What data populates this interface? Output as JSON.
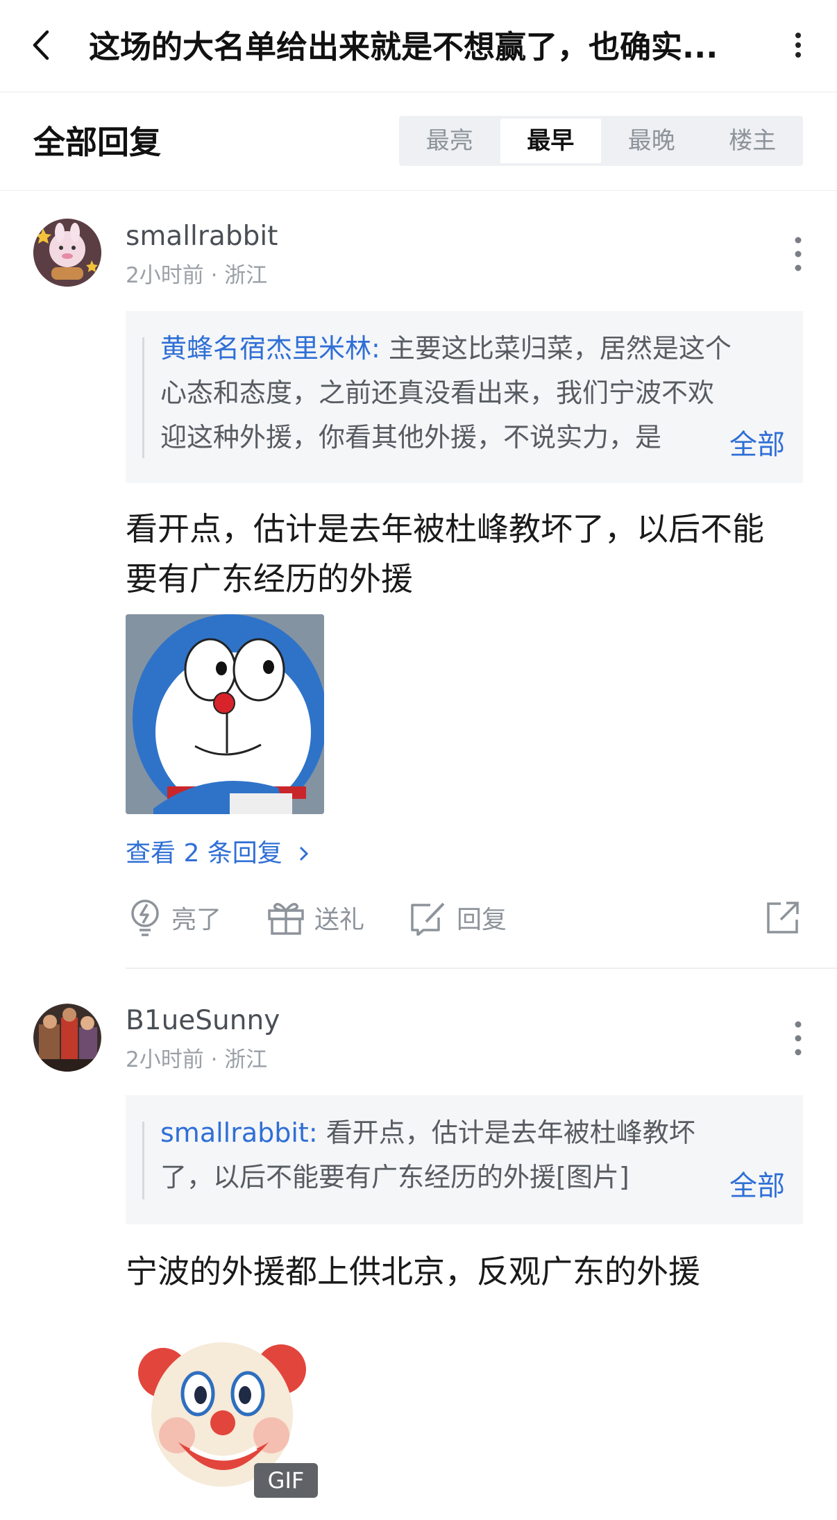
{
  "header": {
    "title": "这场的大名单给出来就是不想赢了，也确实..."
  },
  "section": {
    "title": "全部回复",
    "sort_tabs": [
      "最亮",
      "最早",
      "最晚",
      "楼主"
    ],
    "active_tab": "最早"
  },
  "comments": [
    {
      "username": "smallrabbit",
      "time": "2小时前",
      "location": "浙江",
      "quote": {
        "author": "黄蜂名宿杰里米林:",
        "line1": " 主要这比菜归菜，居然是这个",
        "line2": "心态和态度，之前还真没看出来，我们宁波不欢",
        "line3": "迎这种外援，你看其他外援，不说实力，是"
      },
      "quote_more": "全部",
      "text_line1": "看开点，估计是去年被杜峰教坏了，以后不能",
      "text_line2": "要有广东经历的外援",
      "view_replies": "查看 2 条回复",
      "actions": {
        "light": "亮了",
        "gift": "送礼",
        "reply": "回复"
      }
    },
    {
      "username": "B1ueSunny",
      "time": "2小时前",
      "location": "浙江",
      "quote": {
        "author": "smallrabbit:",
        "line1": " 看开点，估计是去年被杜峰教坏",
        "line2": "了，以后不能要有广东经历的外援[图片]"
      },
      "quote_more": "全部",
      "text_line1": "宁波的外援都上供北京，反观广东的外援",
      "gif_label": "GIF"
    }
  ],
  "colors": {
    "link_blue": "#2f6fd6",
    "muted_gray": "#9aa0a6",
    "quote_bg": "#f5f6f8"
  },
  "icons": [
    "back-arrow-icon",
    "more-vertical-icon",
    "lightbulb-icon",
    "gift-icon",
    "reply-edit-icon",
    "share-icon",
    "chevron-right-icon"
  ]
}
